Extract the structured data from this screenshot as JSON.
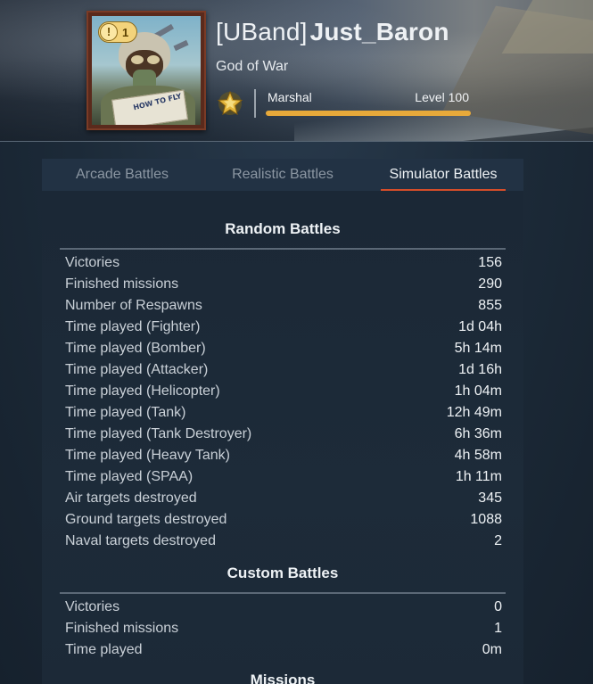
{
  "profile": {
    "clan_tag": "[UBand]",
    "nickname": "Just_Baron",
    "title": "God of War",
    "rank_name": "Marshal",
    "level_label": "Level 100",
    "level_progress": 1.0,
    "avatar_badge_count": "1",
    "avatar_book_text": "HOW TO FLY",
    "colors": {
      "progress": "#e7a93a",
      "badge": "#f3d37b",
      "tab_underline": "#d54d2a"
    }
  },
  "tabs": [
    {
      "label": "Arcade Battles",
      "active": false
    },
    {
      "label": "Realistic Battles",
      "active": false
    },
    {
      "label": "Simulator Battles",
      "active": true
    }
  ],
  "random_battles": {
    "title": "Random Battles",
    "rows": [
      {
        "label": "Victories",
        "value": "156"
      },
      {
        "label": "Finished missions",
        "value": "290"
      },
      {
        "label": "Number of Respawns",
        "value": "855"
      },
      {
        "label": "Time played (Fighter)",
        "value": "1d 04h"
      },
      {
        "label": "Time played (Bomber)",
        "value": "5h 14m"
      },
      {
        "label": "Time played (Attacker)",
        "value": "1d 16h"
      },
      {
        "label": "Time played (Helicopter)",
        "value": "1h 04m"
      },
      {
        "label": "Time played (Tank)",
        "value": "12h 49m"
      },
      {
        "label": "Time played (Tank Destroyer)",
        "value": "6h 36m"
      },
      {
        "label": "Time played (Heavy Tank)",
        "value": "4h 58m"
      },
      {
        "label": "Time played (SPAA)",
        "value": "1h 11m"
      },
      {
        "label": "Air targets destroyed",
        "value": "345"
      },
      {
        "label": "Ground targets destroyed",
        "value": "1088"
      },
      {
        "label": "Naval targets destroyed",
        "value": "2"
      }
    ]
  },
  "custom_battles": {
    "title": "Custom Battles",
    "rows": [
      {
        "label": "Victories",
        "value": "0"
      },
      {
        "label": "Finished missions",
        "value": "1"
      },
      {
        "label": "Time played",
        "value": "0m"
      }
    ]
  },
  "missions": {
    "title": "Missions"
  }
}
